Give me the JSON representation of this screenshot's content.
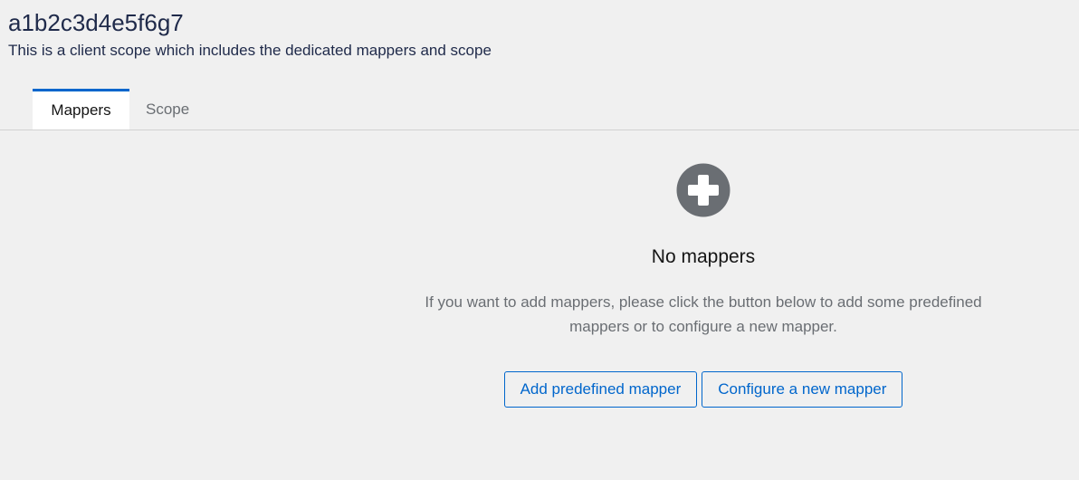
{
  "header": {
    "title": "a1b2c3d4e5f6g7",
    "subtitle": "This is a client scope which includes the dedicated mappers and scope"
  },
  "tabs": [
    {
      "label": "Mappers",
      "active": true
    },
    {
      "label": "Scope",
      "active": false
    }
  ],
  "empty_state": {
    "icon": "plus-circle-icon",
    "title": "No mappers",
    "body_line1": "If you want to add mappers, please click the button below to add some predefined",
    "body_line2": "mappers or to configure a new mapper.",
    "primary_action": "Add predefined mapper",
    "secondary_action": "Configure a new mapper"
  },
  "colors": {
    "accent": "#0066cc",
    "icon": "#6a6e73",
    "background": "#f0f0f0"
  }
}
